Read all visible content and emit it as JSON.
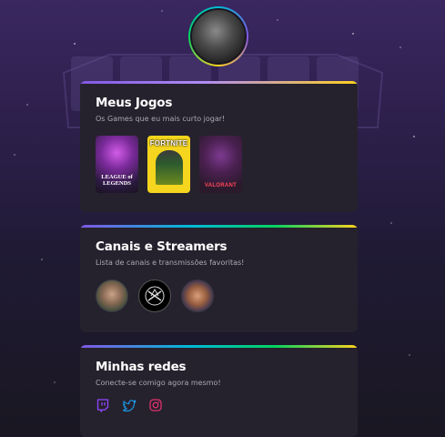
{
  "profile": {
    "avatar_icon": "profile-photo"
  },
  "games_card": {
    "title": "Meus Jogos",
    "subtitle": "Os Games que eu mais curto jogar!",
    "games": [
      {
        "name_line1": "LEAGUE of",
        "name_line2": "LEGENDS",
        "icon": "league-of-legends-cover"
      },
      {
        "name": "FORTNITE",
        "icon": "fortnite-cover"
      },
      {
        "name": "VALORANT",
        "icon": "valorant-cover"
      }
    ]
  },
  "streamers_card": {
    "title": "Canais e Streamers",
    "subtitle": "Lista de canais e transmissões favoritas!",
    "channels": [
      {
        "icon": "streamer-avatar"
      },
      {
        "icon": "channel-logo"
      },
      {
        "icon": "streamer-avatar"
      }
    ]
  },
  "social_card": {
    "title": "Minhas redes",
    "subtitle": "Conecte-se comigo agora mesmo!",
    "links": [
      {
        "icon": "twitch-icon",
        "color": "#9146ff"
      },
      {
        "icon": "twitter-icon",
        "color": "#1d9bf0"
      },
      {
        "icon": "instagram-icon",
        "color": "#e1306c"
      }
    ]
  },
  "colors": {
    "background_top": "#3a2760",
    "background_bottom": "#1a1722",
    "card": "#25222d",
    "accent_purple": "#8257e5",
    "accent_yellow": "#ffd21e"
  }
}
